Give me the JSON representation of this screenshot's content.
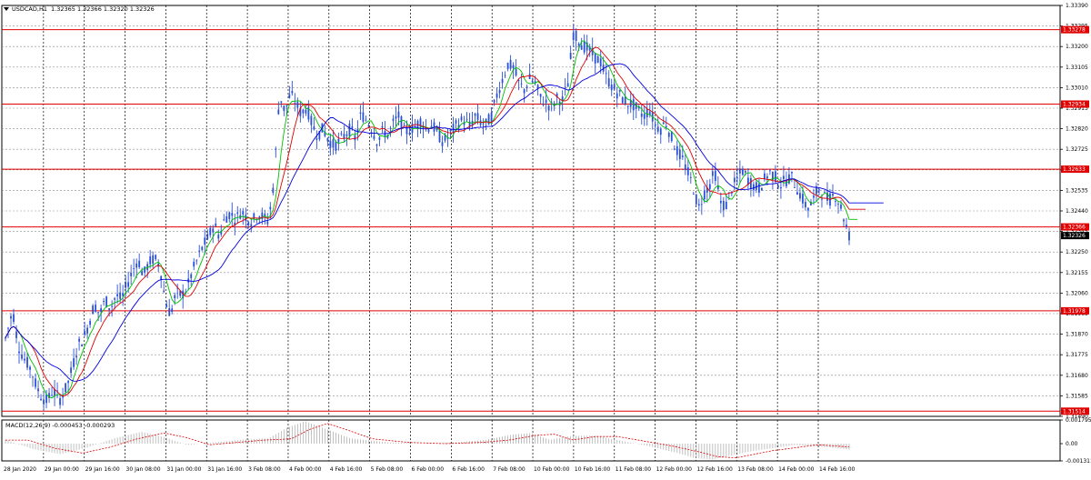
{
  "header": {
    "symbol": "USDCAD,H1",
    "ohlc": "1.32365 1.32366 1.32320 1.32326"
  },
  "colors": {
    "background": "#ffffff",
    "grid": "#8a8a8a",
    "candles": "#2b50d8",
    "ma_fast": "#00c000",
    "ma_mid": "#e00000",
    "ma_slow": "#0000e0",
    "level_lines": "#e00000",
    "level_label_bg": "#e00000",
    "current_price_bg": "#000000",
    "macd_hist": "#b0b0b0",
    "macd_signal": "#e00000"
  },
  "chart_data": [
    {
      "type": "candlestick",
      "symbol": "USDCAD",
      "timeframe": "H1",
      "title": "USDCAD,H1",
      "y_ticks": [
        "1.33390",
        "1.33295",
        "1.33200",
        "1.33105",
        "1.33010",
        "1.32915",
        "1.32820",
        "1.32725",
        "1.32630",
        "1.32535",
        "1.32440",
        "1.32345",
        "1.32250",
        "1.32155",
        "1.32060",
        "1.31965",
        "1.31870",
        "1.31775",
        "1.31680",
        "1.31585",
        "1.31490"
      ],
      "ylim": [
        1.3149,
        1.3339
      ],
      "x_labels": [
        "28 Jan 2020",
        "29 Jan 00:00",
        "29 Jan 16:00",
        "30 Jan 08:00",
        "31 Jan 00:00",
        "31 Jan 16:00",
        "3 Feb 08:00",
        "4 Feb 00:00",
        "4 Feb 16:00",
        "5 Feb 08:00",
        "6 Feb 00:00",
        "6 Feb 16:00",
        "7 Feb 08:00",
        "10 Feb 00:00",
        "10 Feb 16:00",
        "11 Feb 08:00",
        "12 Feb 00:00",
        "12 Feb 16:00",
        "13 Feb 08:00",
        "14 Feb 00:00",
        "14 Feb 16:00"
      ],
      "levels": [
        {
          "value": 1.33278,
          "label": "1.33278"
        },
        {
          "value": 1.32934,
          "label": "1.32934"
        },
        {
          "value": 1.32633,
          "label": "1.32633"
        },
        {
          "value": 1.32366,
          "label": "1.32366"
        },
        {
          "value": 1.31978,
          "label": "1.31978"
        },
        {
          "value": 1.31514,
          "label": "1.31514"
        }
      ],
      "current_price": {
        "value": 1.32326,
        "label": "1.32326"
      },
      "price_path": [
        [
          0,
          1.3185
        ],
        [
          8,
          1.3198
        ],
        [
          14,
          1.3182
        ],
        [
          20,
          1.3176
        ],
        [
          28,
          1.3171
        ],
        [
          34,
          1.3163
        ],
        [
          40,
          1.3158
        ],
        [
          46,
          1.3156
        ],
        [
          52,
          1.3161
        ],
        [
          60,
          1.3157
        ],
        [
          68,
          1.3163
        ],
        [
          74,
          1.3172
        ],
        [
          80,
          1.3182
        ],
        [
          86,
          1.3185
        ],
        [
          92,
          1.3192
        ],
        [
          98,
          1.3201
        ],
        [
          104,
          1.3196
        ],
        [
          110,
          1.3203
        ],
        [
          116,
          1.3199
        ],
        [
          122,
          1.3205
        ],
        [
          128,
          1.3203
        ],
        [
          134,
          1.321
        ],
        [
          140,
          1.3216
        ],
        [
          146,
          1.3222
        ],
        [
          152,
          1.3214
        ],
        [
          158,
          1.322
        ],
        [
          164,
          1.3222
        ],
        [
          170,
          1.3219
        ],
        [
          176,
          1.3203
        ],
        [
          182,
          1.3196
        ],
        [
          188,
          1.3206
        ],
        [
          194,
          1.3205
        ],
        [
          200,
          1.3208
        ],
        [
          206,
          1.3216
        ],
        [
          212,
          1.3222
        ],
        [
          218,
          1.3228
        ],
        [
          224,
          1.3232
        ],
        [
          230,
          1.3238
        ],
        [
          236,
          1.3232
        ],
        [
          242,
          1.3241
        ],
        [
          248,
          1.3243
        ],
        [
          254,
          1.324
        ],
        [
          260,
          1.3244
        ],
        [
          266,
          1.3241
        ],
        [
          272,
          1.3239
        ],
        [
          278,
          1.3243
        ],
        [
          284,
          1.3241
        ],
        [
          290,
          1.3239
        ],
        [
          296,
          1.3258
        ],
        [
          302,
          1.3298
        ],
        [
          308,
          1.329
        ],
        [
          314,
          1.3298
        ],
        [
          320,
          1.3294
        ],
        [
          326,
          1.3289
        ],
        [
          332,
          1.3292
        ],
        [
          338,
          1.3284
        ],
        [
          344,
          1.3279
        ],
        [
          350,
          1.3282
        ],
        [
          356,
          1.3277
        ],
        [
          362,
          1.3274
        ],
        [
          368,
          1.3276
        ],
        [
          374,
          1.3279
        ],
        [
          380,
          1.3282
        ],
        [
          386,
          1.3277
        ],
        [
          392,
          1.3289
        ],
        [
          398,
          1.3286
        ],
        [
          404,
          1.3282
        ],
        [
          410,
          1.3276
        ],
        [
          416,
          1.3281
        ],
        [
          422,
          1.3279
        ],
        [
          428,
          1.3285
        ],
        [
          434,
          1.3288
        ],
        [
          440,
          1.328
        ],
        [
          446,
          1.3282
        ],
        [
          452,
          1.3283
        ],
        [
          458,
          1.3286
        ],
        [
          464,
          1.3282
        ],
        [
          470,
          1.3284
        ],
        [
          476,
          1.328
        ],
        [
          482,
          1.3276
        ],
        [
          488,
          1.3278
        ],
        [
          494,
          1.3282
        ],
        [
          500,
          1.3285
        ],
        [
          506,
          1.3286
        ],
        [
          512,
          1.3283
        ],
        [
          518,
          1.3288
        ],
        [
          524,
          1.3285
        ],
        [
          530,
          1.3284
        ],
        [
          536,
          1.3288
        ],
        [
          542,
          1.3298
        ],
        [
          548,
          1.3305
        ],
        [
          554,
          1.3312
        ],
        [
          560,
          1.331
        ],
        [
          566,
          1.3303
        ],
        [
          572,
          1.33
        ],
        [
          578,
          1.3305
        ],
        [
          584,
          1.3303
        ],
        [
          590,
          1.3296
        ],
        [
          596,
          1.3294
        ],
        [
          602,
          1.3292
        ],
        [
          608,
          1.3296
        ],
        [
          614,
          1.3295
        ],
        [
          620,
          1.3303
        ],
        [
          626,
          1.3326
        ],
        [
          632,
          1.3323
        ],
        [
          638,
          1.332
        ],
        [
          644,
          1.3318
        ],
        [
          650,
          1.3315
        ],
        [
          656,
          1.3313
        ],
        [
          662,
          1.3306
        ],
        [
          668,
          1.3302
        ],
        [
          674,
          1.3299
        ],
        [
          680,
          1.3296
        ],
        [
          686,
          1.3294
        ],
        [
          692,
          1.3293
        ],
        [
          698,
          1.329
        ],
        [
          704,
          1.3288
        ],
        [
          710,
          1.3291
        ],
        [
          716,
          1.3284
        ],
        [
          722,
          1.3282
        ],
        [
          728,
          1.3285
        ],
        [
          734,
          1.3278
        ],
        [
          740,
          1.3272
        ],
        [
          746,
          1.3268
        ],
        [
          752,
          1.3262
        ],
        [
          758,
          1.3255
        ],
        [
          764,
          1.3245
        ],
        [
          770,
          1.3252
        ],
        [
          776,
          1.3256
        ],
        [
          782,
          1.3262
        ],
        [
          788,
          1.3248
        ],
        [
          794,
          1.3246
        ],
        [
          800,
          1.3254
        ],
        [
          806,
          1.3258
        ],
        [
          812,
          1.3263
        ],
        [
          818,
          1.3259
        ],
        [
          824,
          1.3256
        ],
        [
          830,
          1.3254
        ],
        [
          836,
          1.3258
        ],
        [
          842,
          1.3262
        ],
        [
          848,
          1.326
        ],
        [
          854,
          1.3256
        ],
        [
          860,
          1.3258
        ],
        [
          866,
          1.326
        ],
        [
          872,
          1.3255
        ],
        [
          878,
          1.325
        ],
        [
          884,
          1.3245
        ],
        [
          890,
          1.3248
        ],
        [
          896,
          1.3255
        ],
        [
          902,
          1.3251
        ],
        [
          908,
          1.3249
        ],
        [
          914,
          1.3252
        ],
        [
          920,
          1.3247
        ],
        [
          926,
          1.3238
        ],
        [
          930,
          1.32326
        ]
      ],
      "moving_averages": [
        {
          "key": "ma_fast",
          "period": 5
        },
        {
          "key": "ma_mid",
          "period": 10
        },
        {
          "key": "ma_slow",
          "period": 21
        }
      ]
    },
    {
      "type": "macd",
      "label": "MACD(12,26,9) -0.000453 -0.000293",
      "y_ticks": [
        "0.001795",
        "0.00",
        "-0.001311"
      ],
      "ylim": [
        -0.001311,
        0.001795
      ],
      "hist_path": [
        [
          0,
          0.0003
        ],
        [
          30,
          -0.0004
        ],
        [
          60,
          -0.0008
        ],
        [
          90,
          -0.0003
        ],
        [
          120,
          0.0004
        ],
        [
          150,
          0.0009
        ],
        [
          175,
          0.0005
        ],
        [
          200,
          -0.0001
        ],
        [
          230,
          0.0001
        ],
        [
          260,
          0.0003
        ],
        [
          290,
          0.0004
        ],
        [
          310,
          0.0012
        ],
        [
          330,
          0.0017
        ],
        [
          350,
          0.0012
        ],
        [
          380,
          0.0004
        ],
        [
          420,
          0.0001
        ],
        [
          460,
          0.0
        ],
        [
          500,
          0.0001
        ],
        [
          530,
          0.0003
        ],
        [
          560,
          0.0007
        ],
        [
          580,
          0.0008
        ],
        [
          600,
          0.0003
        ],
        [
          625,
          0.0006
        ],
        [
          650,
          0.0006
        ],
        [
          680,
          0.0002
        ],
        [
          710,
          -0.0002
        ],
        [
          740,
          -0.0007
        ],
        [
          760,
          -0.0011
        ],
        [
          780,
          -0.0012
        ],
        [
          800,
          -0.0009
        ],
        [
          820,
          -0.0006
        ],
        [
          850,
          -0.0003
        ],
        [
          870,
          -0.0001
        ],
        [
          890,
          -0.0002
        ],
        [
          910,
          -0.0003
        ],
        [
          930,
          -0.000453
        ]
      ]
    }
  ]
}
